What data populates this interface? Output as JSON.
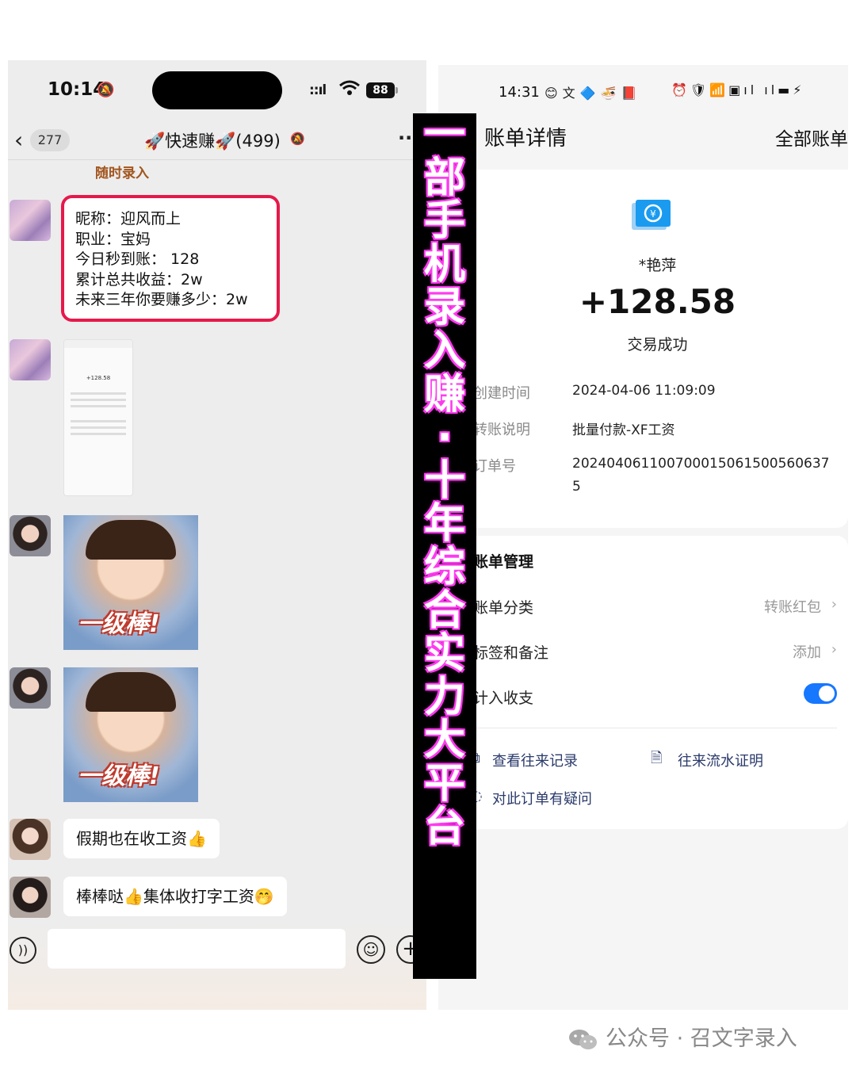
{
  "left_phone": {
    "status_bar": {
      "time": "10:14",
      "signal": "ıll",
      "battery": "88"
    },
    "header": {
      "back_count": "277",
      "group_title": "🚀快速赚🚀(499)"
    },
    "sender_tag": "随时录入",
    "info_card": {
      "lines": [
        "昵称：迎风而上",
        "职业：宝妈",
        "今日秒到账： 128",
        "累计总共收益：2w",
        "未来三年你要赚多少：2w"
      ]
    },
    "thumbnail": {
      "amount": "+128.58"
    },
    "sticker_text": "一级棒!",
    "messages": [
      "假期也在收工资👍",
      "棒棒哒👍集体收打字工资🤭"
    ]
  },
  "right_phone": {
    "status_bar": {
      "time": "14:31"
    },
    "header": {
      "title": "账单详情",
      "all_bills": "全部账单"
    },
    "payer": "*艳萍",
    "amount": "+128.58",
    "status": "交易成功",
    "rows": [
      {
        "label": "创建时间",
        "value": "2024-04-06 11:09:09"
      },
      {
        "label": "转账说明",
        "value": "批量付款-XF工资"
      },
      {
        "label": "订单号",
        "value": "20240406110070001506150056063755"
      }
    ],
    "order_line1": "202404061100700015061500560637",
    "order_line2": "5",
    "management": {
      "title": "账单管理",
      "category_label": "账单分类",
      "category_value": "转账红包",
      "tags_label": "标签和备注",
      "tags_value": "添加",
      "include_label": "计入收支",
      "include_on": true
    },
    "links": {
      "history": "查看往来记录",
      "proof": "往来流水证明",
      "question": "对此订单有疑问"
    }
  },
  "banner": {
    "text": "一部手机录入赚·十年综合实力大平台"
  },
  "watermark": {
    "text": "公众号 · 召文字录入"
  },
  "colors": {
    "highlight_border": "#e6194b",
    "banner_glow": "#ff3cf0",
    "toggle": "#1677ff",
    "sender_tag": "#a2551e"
  }
}
